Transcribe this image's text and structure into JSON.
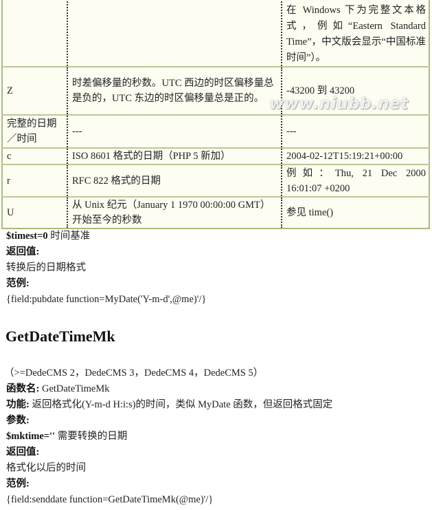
{
  "table": {
    "rows": [
      {
        "code": "",
        "desc": "",
        "example": "在 Windows 下为完整文本格式，例如“Eastern Standard Time”，中文版会显示“中国标准时间”）。"
      },
      {
        "code": "Z",
        "desc": "时差偏移量的秒数。UTC 西边的时区偏移量总是负的，UTC 东边的时区偏移量总是正的。",
        "example": "-43200 到 43200"
      },
      {
        "code": "完整的日期／时间",
        "desc": "---",
        "example": "---"
      },
      {
        "code": "c",
        "desc": "ISO 8601 格式的日期（PHP 5 新加）",
        "example": "2004-02-12T15:19:21+00:00"
      },
      {
        "code": "r",
        "desc": "RFC 822 格式的日期",
        "example": "例如：Thu, 21 Dec 2000 16:01:07 +0200"
      },
      {
        "code": "U",
        "desc": "从 Unix 纪元（January 1 1970 00:00:00 GMT）开始至今的秒数",
        "example": "参见 time()"
      }
    ]
  },
  "watermark": "www.niubb.net",
  "mydate": {
    "param_name": "$timest=0",
    "param_desc": " 时间基准",
    "return_label": "返回值:",
    "return_value": "转换后的日期格式",
    "example_label": "范例:",
    "example_code": "{field:pubdate function=MyDate('Y-m-d',@me)'/}"
  },
  "getdatetimemk": {
    "title": "GetDateTimeMk",
    "versions": "（>=DedeCMS 2，DedeCMS 3，DedeCMS 4，DedeCMS 5）",
    "func_name_label": "函数名:",
    "func_name_value": " GetDateTimeMk",
    "function_label": "功能:",
    "function_value": " 返回格式化(Y-m-d H:i:s)的时间，类似 MyDate 函数，但返回格式固定",
    "params_label": "参数:",
    "param_name": "$mktime=''",
    "param_desc": " 需要转换的日期",
    "return_label": "返回值:",
    "return_value": "格式化以后的时间",
    "example_label": "范例:",
    "example_code": "{field:senddate function=GetDateTimeMk(@me)'/}"
  }
}
